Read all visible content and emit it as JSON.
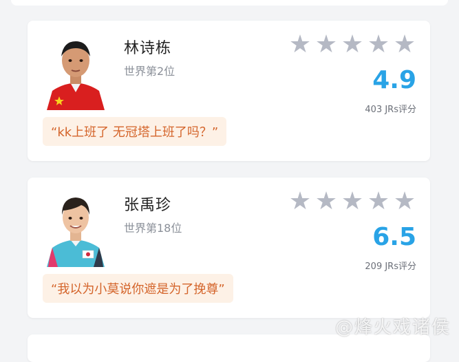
{
  "players": [
    {
      "name": "林诗栋",
      "rank": "世界第2位",
      "score": "4.9",
      "count": "403 JRs评分",
      "quote": "“kk上班了 无冠塔上班了吗？”",
      "stars": [
        "star-icon",
        "star-icon",
        "star-icon",
        "star-icon",
        "star-icon"
      ],
      "jersey_color": "#d91f1f"
    },
    {
      "name": "张禹珍",
      "rank": "世界第18位",
      "score": "6.5",
      "count": "209 JRs评分",
      "quote": "“我以为小莫说你遮是为了挽尊”",
      "stars": [
        "star-icon",
        "star-icon",
        "star-icon",
        "star-icon",
        "star-icon"
      ],
      "jersey_color": "#4bbcd6"
    }
  ],
  "watermark": "@烽火戏诸侯",
  "colors": {
    "score": "#29a3e6",
    "star_empty": "#b5b9c4",
    "quote_bg": "#fdf1e6",
    "quote_text": "#d4642a"
  }
}
